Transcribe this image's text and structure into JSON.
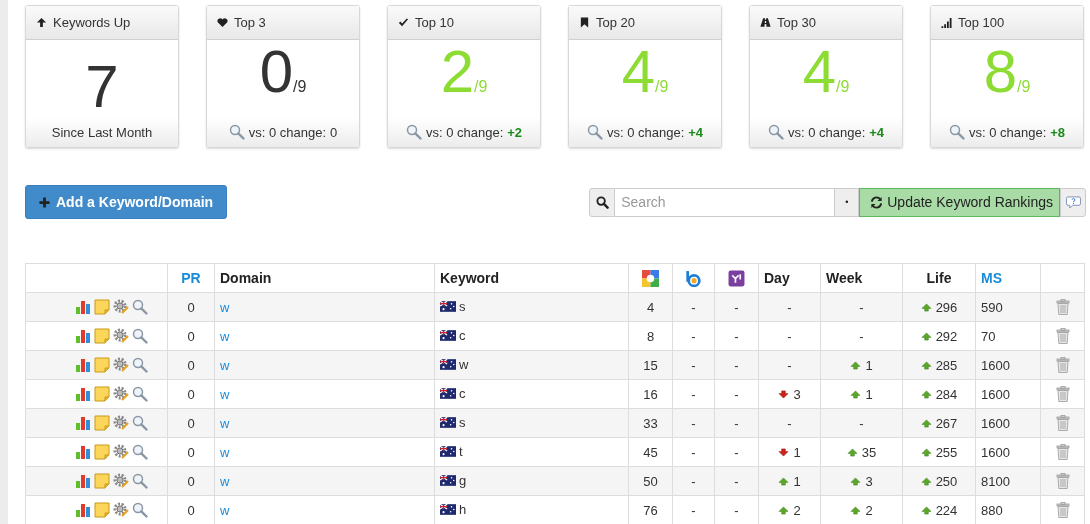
{
  "cards": [
    {
      "kind": "summary",
      "title": "Keywords Up",
      "value": "7",
      "highlight": false,
      "footer": "Since Last Month"
    },
    {
      "kind": "rank",
      "title": "Top 3",
      "value": "0",
      "total": "/9",
      "highlight": false,
      "vs": "vs: 0 change:",
      "change": "0",
      "change_positive": false
    },
    {
      "kind": "rank",
      "title": "Top 10",
      "value": "2",
      "total": "/9",
      "highlight": true,
      "vs": "vs: 0 change:",
      "change": "+2",
      "change_positive": true
    },
    {
      "kind": "rank",
      "title": "Top 20",
      "value": "4",
      "total": "/9",
      "highlight": true,
      "vs": "vs: 0 change:",
      "change": "+4",
      "change_positive": true
    },
    {
      "kind": "rank",
      "title": "Top 30",
      "value": "4",
      "total": "/9",
      "highlight": true,
      "vs": "vs: 0 change:",
      "change": "+4",
      "change_positive": true
    },
    {
      "kind": "rank",
      "title": "Top 100",
      "value": "8",
      "total": "/9",
      "highlight": true,
      "vs": "vs: 0 change:",
      "change": "+8",
      "change_positive": true
    }
  ],
  "add_button": "Add a Keyword/Domain",
  "search": {
    "placeholder": "Search",
    "separator": "•",
    "update_button": "Update Keyword Rankings"
  },
  "table": {
    "columns": [
      {
        "kind": "blank"
      },
      {
        "kind": "link",
        "label": "PR"
      },
      {
        "kind": "text",
        "label": "Domain"
      },
      {
        "kind": "text",
        "label": "Keyword"
      },
      {
        "kind": "icon"
      },
      {
        "kind": "icon"
      },
      {
        "kind": "icon"
      },
      {
        "kind": "text",
        "label": "Day"
      },
      {
        "kind": "text",
        "label": "Week"
      },
      {
        "kind": "text",
        "label": "Life"
      },
      {
        "kind": "link",
        "label": "MS"
      },
      {
        "kind": "blank"
      }
    ],
    "rows": [
      {
        "pr": "0",
        "domain": "w",
        "keyword": "s",
        "google": "4",
        "bing": "-",
        "yahoo": "-",
        "day": {
          "kind": "none",
          "value": "-"
        },
        "week": {
          "kind": "none",
          "value": "-"
        },
        "life": {
          "kind": "up",
          "value": "296"
        },
        "ms": "590"
      },
      {
        "pr": "0",
        "domain": "w",
        "keyword": "c",
        "google": "8",
        "bing": "-",
        "yahoo": "-",
        "day": {
          "kind": "none",
          "value": "-"
        },
        "week": {
          "kind": "none",
          "value": "-"
        },
        "life": {
          "kind": "up",
          "value": "292"
        },
        "ms": "70"
      },
      {
        "pr": "0",
        "domain": "w",
        "keyword": "w",
        "google": "15",
        "bing": "-",
        "yahoo": "-",
        "day": {
          "kind": "none",
          "value": "-"
        },
        "week": {
          "kind": "up",
          "value": "1"
        },
        "life": {
          "kind": "up",
          "value": "285"
        },
        "ms": "1600"
      },
      {
        "pr": "0",
        "domain": "w",
        "keyword": "c",
        "google": "16",
        "bing": "-",
        "yahoo": "-",
        "day": {
          "kind": "down",
          "value": "3"
        },
        "week": {
          "kind": "up",
          "value": "1"
        },
        "life": {
          "kind": "up",
          "value": "284"
        },
        "ms": "1600"
      },
      {
        "pr": "0",
        "domain": "w",
        "keyword": "s",
        "google": "33",
        "bing": "-",
        "yahoo": "-",
        "day": {
          "kind": "none",
          "value": "-"
        },
        "week": {
          "kind": "none",
          "value": "-"
        },
        "life": {
          "kind": "up",
          "value": "267"
        },
        "ms": "1600"
      },
      {
        "pr": "0",
        "domain": "w",
        "keyword": "t",
        "google": "45",
        "bing": "-",
        "yahoo": "-",
        "day": {
          "kind": "down",
          "value": "1"
        },
        "week": {
          "kind": "up",
          "value": "35"
        },
        "life": {
          "kind": "up",
          "value": "255"
        },
        "ms": "1600"
      },
      {
        "pr": "0",
        "domain": "w",
        "keyword": "g",
        "google": "50",
        "bing": "-",
        "yahoo": "-",
        "day": {
          "kind": "up",
          "value": "1"
        },
        "week": {
          "kind": "up",
          "value": "3"
        },
        "life": {
          "kind": "up",
          "value": "250"
        },
        "ms": "8100"
      },
      {
        "pr": "0",
        "domain": "w",
        "keyword": "h",
        "google": "76",
        "bing": "-",
        "yahoo": "-",
        "day": {
          "kind": "up",
          "value": "2"
        },
        "week": {
          "kind": "up",
          "value": "2"
        },
        "life": {
          "kind": "up",
          "value": "224"
        },
        "ms": "880"
      }
    ]
  }
}
